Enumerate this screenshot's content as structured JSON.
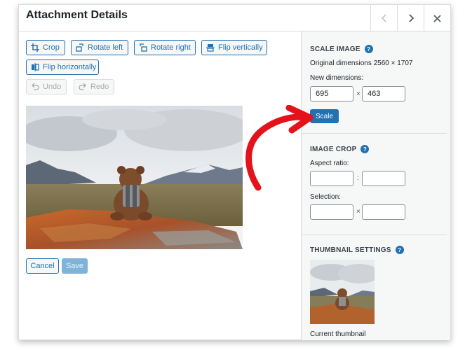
{
  "header": {
    "title": "Attachment Details",
    "prev_icon": "chevron-left-icon",
    "next_icon": "chevron-right-icon",
    "close_icon": "close-icon"
  },
  "toolbar": {
    "crop": "Crop",
    "rotate_left": "Rotate left",
    "rotate_right": "Rotate right",
    "flip_vertically": "Flip vertically",
    "flip_horizontally": "Flip horizontally",
    "undo": "Undo",
    "redo": "Redo"
  },
  "actions": {
    "cancel": "Cancel",
    "save": "Save"
  },
  "scale_image": {
    "title": "SCALE IMAGE",
    "original": "Original dimensions 2560 × 1707",
    "new_label": "New dimensions:",
    "width": "695",
    "height": "463",
    "separator": "×",
    "button": "Scale"
  },
  "image_crop": {
    "title": "IMAGE CROP",
    "aspect_label": "Aspect ratio:",
    "aspect_separator": ":",
    "aspect_w": "",
    "aspect_h": "",
    "selection_label": "Selection:",
    "selection_separator": "×",
    "selection_w": "",
    "selection_h": ""
  },
  "thumbnail": {
    "title": "THUMBNAIL SETTINGS",
    "caption": "Current thumbnail"
  },
  "colors": {
    "accent": "#2271b1",
    "annotation_arrow": "#e3121b"
  }
}
